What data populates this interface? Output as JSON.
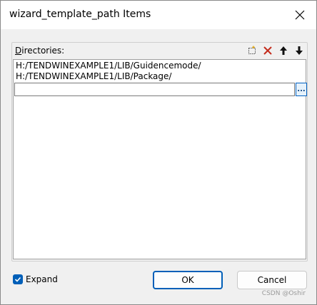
{
  "window": {
    "title": "wizard_template_path Items"
  },
  "directories": {
    "label_mnemonic": "D",
    "label_rest": "irectories:",
    "items": [
      "H:/TENDWINEXAMPLE1/LIB/Guidencemode/",
      "H:/TENDWINEXAMPLE1/LIB/Package/"
    ],
    "edit_value": "",
    "browse_label": "..."
  },
  "toolbar": {
    "icons": [
      "new-folder-icon",
      "delete-icon",
      "move-up-icon",
      "move-down-icon"
    ]
  },
  "expand": {
    "label": "Expand",
    "checked": true
  },
  "buttons": {
    "ok": "OK",
    "cancel": "Cancel"
  },
  "watermark": "CSDN @Oshir",
  "colors": {
    "accent": "#005fb8",
    "delete": "#c42b1c",
    "background": "#f0f0f0"
  }
}
